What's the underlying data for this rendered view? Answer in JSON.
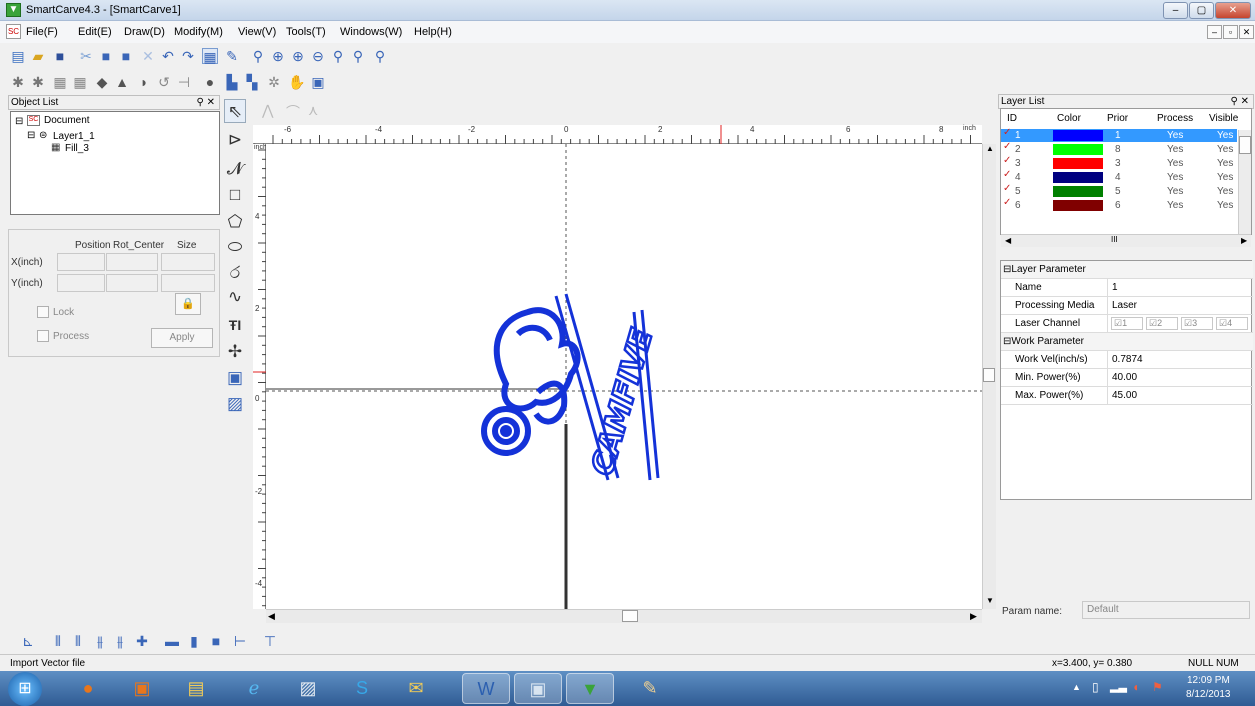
{
  "window": {
    "title": "SmartCarve4.3 - [SmartCarve1]",
    "minimize": "–",
    "maximize": "▢",
    "close": "✕"
  },
  "menu": [
    "File(F)",
    "Edit(E)",
    "Draw(D)",
    "Modify(M)",
    "View(V)",
    "Tools(T)",
    "Windows(W)",
    "Help(H)"
  ],
  "object_list": {
    "header": "Object List",
    "pin": "⚲ ✕",
    "tree": {
      "document": "Document",
      "layer": "Layer1_1",
      "fill": "Fill_3"
    }
  },
  "position_panel": {
    "col_position": "Position",
    "col_rot_center": "Rot_Center",
    "col_size": "Size",
    "row_x": "X(inch)",
    "row_y": "Y(inch)",
    "lock": "Lock",
    "process": "Process",
    "apply": "Apply"
  },
  "ruler": {
    "unit": "inch",
    "h_labels": [
      "-6",
      "-4",
      "-2",
      "0",
      "2",
      "4",
      "6",
      "8"
    ],
    "v_labels": [
      "4",
      "2",
      "0",
      "-2",
      "-4"
    ]
  },
  "artwork_text": "CAMFIVE",
  "layer_list": {
    "header": "Layer List",
    "pin": "⚲ ✕",
    "columns": [
      "ID",
      "Color",
      "Prior",
      "Process",
      "Visible"
    ],
    "rows": [
      {
        "id": "1",
        "color": "#0000ff",
        "prior": "1",
        "process": "Yes",
        "visible": "Yes"
      },
      {
        "id": "2",
        "color": "#00ff00",
        "prior": "8",
        "process": "Yes",
        "visible": "Yes"
      },
      {
        "id": "3",
        "color": "#ff0000",
        "prior": "3",
        "process": "Yes",
        "visible": "Yes"
      },
      {
        "id": "4",
        "color": "#000080",
        "prior": "4",
        "process": "Yes",
        "visible": "Yes"
      },
      {
        "id": "5",
        "color": "#008000",
        "prior": "5",
        "process": "Yes",
        "visible": "Yes"
      },
      {
        "id": "6",
        "color": "#800000",
        "prior": "6",
        "process": "Yes",
        "visible": "Yes"
      }
    ]
  },
  "layer_params": {
    "section1": "Layer Parameter",
    "name_k": "Name",
    "name_v": "1",
    "media_k": "Processing Media",
    "media_v": "Laser",
    "channel_k": "Laser Channel",
    "channels": [
      "1",
      "2",
      "3",
      "4"
    ],
    "section2": "Work Parameter",
    "vel_k": "Work Vel(inch/s)",
    "vel_v": "0.7874",
    "minp_k": "Min. Power(%)",
    "minp_v": "40.00",
    "maxp_k": "Max. Power(%)",
    "maxp_v": "45.00"
  },
  "param_name": {
    "label": "Param name:",
    "value": "Default"
  },
  "status": {
    "left": "Import Vector file",
    "coords": "x=3.400, y= 0.380",
    "indicators": "NULL NUM"
  },
  "clock": {
    "time": "12:09 PM",
    "date": "8/12/2013"
  }
}
